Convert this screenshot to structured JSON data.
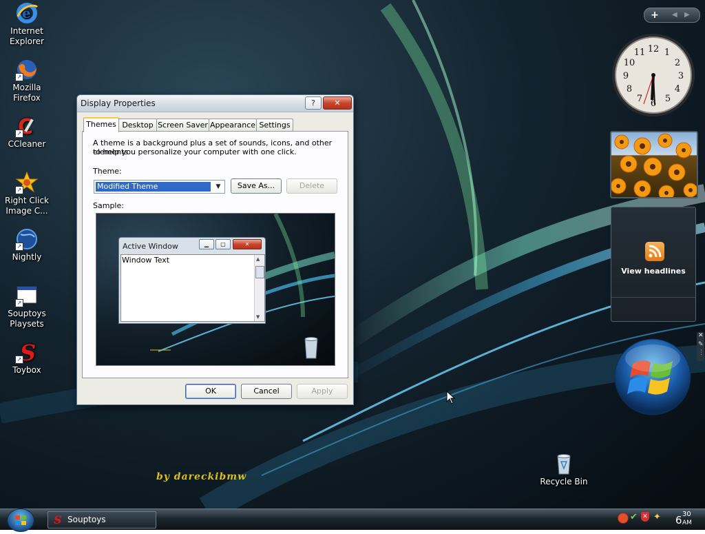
{
  "desktop": {
    "icons": [
      {
        "label1": "Internet",
        "label2": "Explorer"
      },
      {
        "label1": "Mozilla",
        "label2": "Firefox"
      },
      {
        "label1": "CCleaner",
        "label2": ""
      },
      {
        "label1": "Right Click",
        "label2": "Image C..."
      },
      {
        "label1": "Nightly",
        "label2": ""
      },
      {
        "label1": "Souptoys",
        "label2": "Playsets"
      },
      {
        "label1": "Toybox",
        "label2": ""
      }
    ],
    "recycle_bin_label": "Recycle Bin",
    "watermark": "by dareckibmw"
  },
  "dialog": {
    "title": "Display Properties",
    "help_label": "?",
    "close_label": "✕",
    "tabs": [
      "Themes",
      "Desktop",
      "Screen Saver",
      "Appearance",
      "Settings"
    ],
    "active_tab": "Themes",
    "description_line1": "A theme is a background plus a set of sounds, icons, and other elements",
    "description_line2": "to help you personalize your computer with one click.",
    "theme_label": "Theme:",
    "theme_value": "Modified Theme",
    "save_as_label": "Save As...",
    "delete_label": "Delete",
    "sample_label": "Sample:",
    "sample": {
      "window_title": "Active Window",
      "window_text": "Window Text"
    },
    "ok_label": "OK",
    "cancel_label": "Cancel",
    "apply_label": "Apply"
  },
  "sidebar": {
    "add_label": "+",
    "feed_label": "View headlines"
  },
  "taskbar": {
    "task_label": "Souptoys",
    "clock_hour": "6",
    "clock_minutes": "30",
    "clock_ampm": "AM"
  },
  "colors": {
    "selection": "#3169c6",
    "rss": "#f08a24"
  }
}
